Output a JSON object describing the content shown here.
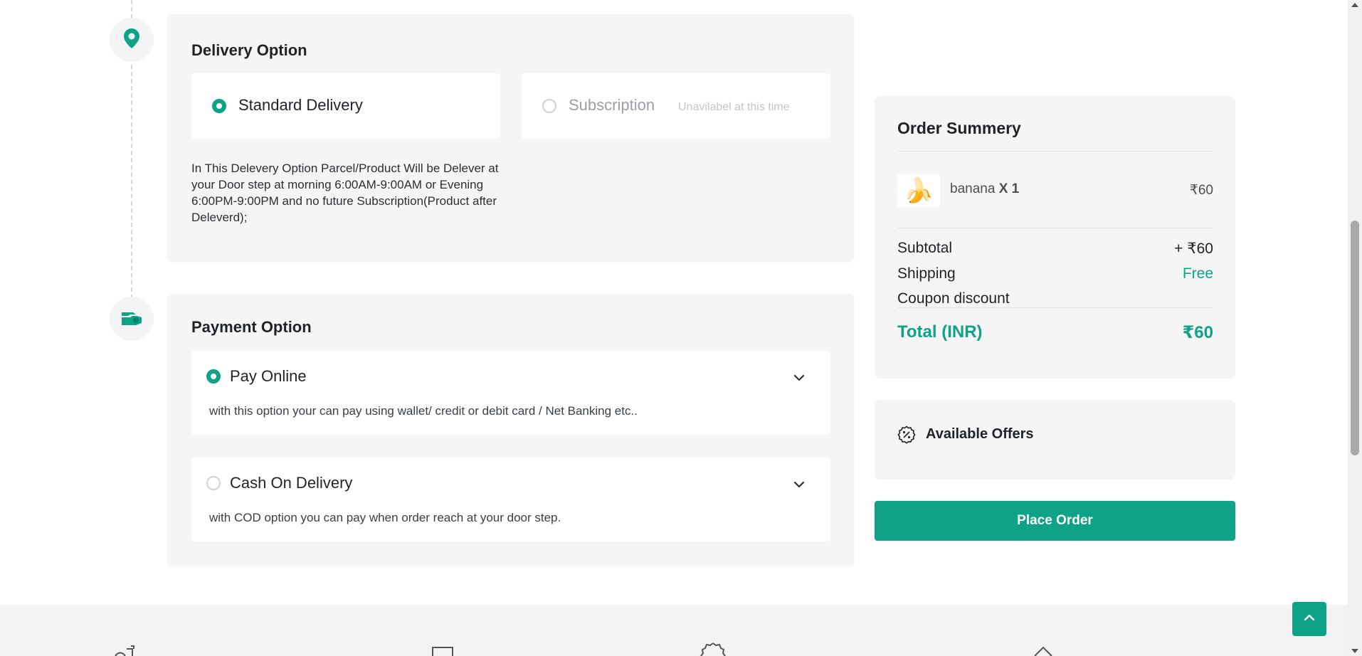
{
  "delivery": {
    "title": "Delivery Option",
    "options": [
      {
        "label": "Standard Delivery",
        "selected": true
      },
      {
        "label": "Subscription",
        "note": "Unavilabel at this time",
        "disabled": true
      }
    ],
    "description": "In This Delevery Option Parcel/Product Will be Delever at your Door step at morning 6:00AM-9:00AM or Evening 6:00PM-9:00PM and no future Subscription(Product after Deleverd);"
  },
  "payment": {
    "title": "Payment Option",
    "options": [
      {
        "label": "Pay Online",
        "selected": true,
        "description": "with this option your can pay using wallet/ credit or debit card / Net Banking etc.."
      },
      {
        "label": "Cash On Delivery",
        "selected": false,
        "description": "with COD option you can pay when order reach at your door step."
      }
    ]
  },
  "summary": {
    "title": "Order Summery",
    "item": {
      "name": "banana",
      "qty": "X 1",
      "price": "₹60",
      "emoji": "🍌"
    },
    "subtotal_label": "Subtotal",
    "subtotal_value": "+ ₹60",
    "shipping_label": "Shipping",
    "shipping_value": "Free",
    "coupon_label": "Coupon discount",
    "coupon_value": "",
    "total_label": "Total (INR)",
    "total_value": "₹60"
  },
  "offers": {
    "label": "Available Offers"
  },
  "place_order": {
    "label": "Place Order"
  },
  "colors": {
    "accent": "#0ea386",
    "card_bg": "#f5f5f5"
  }
}
